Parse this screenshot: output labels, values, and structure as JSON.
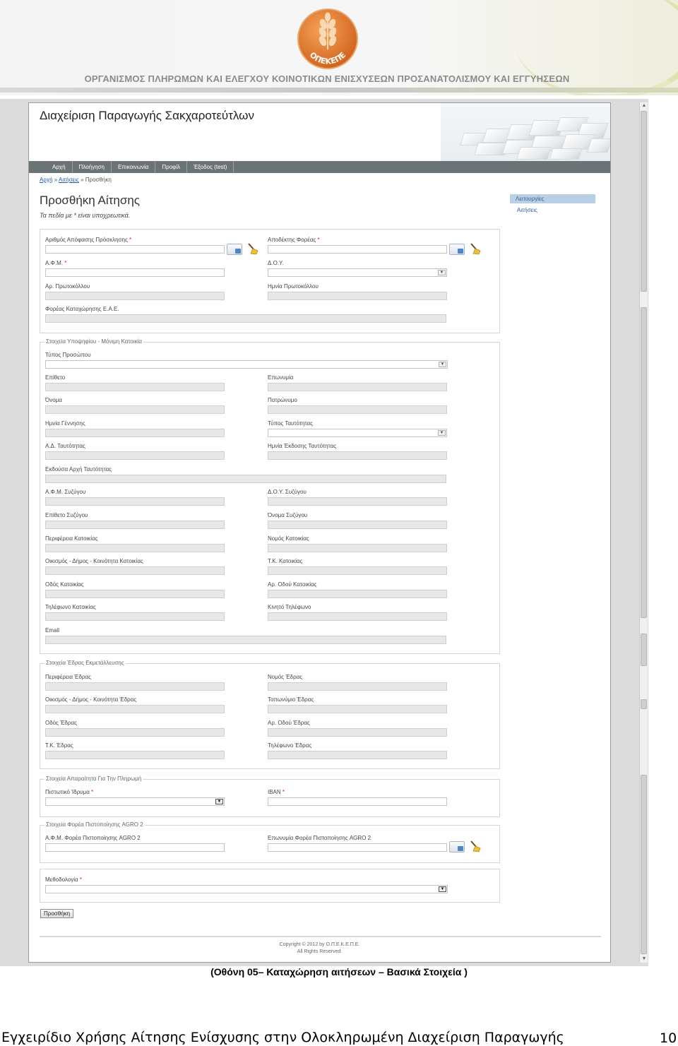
{
  "banner": {
    "title": "ΟΡΓΑΝΙΣΜΟΣ ΠΛΗΡΩΜΩΝ ΚΑΙ ΕΛΕΓΧΟΥ ΚΟΙΝΟΤΙΚΩΝ ΕΝΙΣΧΥΣΕΩΝ ΠΡΟΣΑΝΑΤΟΛΙΣΜΟΥ ΚΑΙ ΕΓΓΥΗΣΕΩΝ",
    "logo_text": "ΟΠΕΚΕΠΕ"
  },
  "app": {
    "title": "Διαχείριση Παραγωγής Σακχαροτεύτλων"
  },
  "nav": {
    "items": [
      "Αρχή",
      "Πλοήγηση",
      "Επικοινωνία",
      "Προφίλ",
      "Έξοδος (test)"
    ]
  },
  "breadcrumb": {
    "home": "Αρχή",
    "sep": " » ",
    "applications": "Αιτήσεις",
    "current": "Προσθήκη"
  },
  "page": {
    "heading": "Προσθήκη Αίτησης",
    "required_note": "Τα πεδία με * είναι υποχρεωτικά."
  },
  "side_menu": {
    "active": "Λειτουργίες",
    "link": "Αιτήσεις"
  },
  "sections": {
    "main": {
      "decision_number": "Αριθμός Απόφασης Πρόσκλησης",
      "recipient": "Αποδέκτης Φορέας",
      "afm": "Α.Φ.Μ.",
      "doy": "Δ.Ο.Υ.",
      "protocol_number": "Αρ. Πρωτοκόλλου",
      "protocol_date": "Ημνία Πρωτοκόλλου",
      "eae_entity": "Φορέας Καταχώρησης Ε.Α.Ε."
    },
    "applicant": {
      "legend": "Στοιχεία Υποψηφίου - Μόνιμη Κατοικία",
      "person_type": "Τύπος Προσώπου",
      "surname": "Επίθετο",
      "company_name": "Επωνυμία",
      "first_name": "Όνομα",
      "father_name": "Πατρώνυμο",
      "birth_date": "Ημνία Γέννησης",
      "id_type": "Τύπος Ταυτότητας",
      "id_number": "Α.Δ. Ταυτότητας",
      "id_issue_date": "Ημνία Έκδοσης Ταυτότητας",
      "id_authority": "Εκδούσα Αρχή Ταυτότητας",
      "spouse_afm": "Α.Φ.Μ. Συζύγου",
      "spouse_doy": "Δ.Ο.Υ. Συζύγου",
      "spouse_surname": "Επίθετο Συζύγου",
      "spouse_name": "Όνομα Συζύγου",
      "region": "Περιφέρεια Κατοικίας",
      "prefecture": "Νομός Κατοικίας",
      "settlement": "Οικισμός - Δήμος - Κοινότητα Κατοικίας",
      "postal_code": "Τ.Κ. Κατοικίας",
      "street": "Οδός Κατοικίας",
      "street_number": "Αρ. Οδού Κατοικίας",
      "phone": "Τηλέφωνο Κατοικίας",
      "mobile": "Κινητό Τηλέφωνο",
      "email": "Email"
    },
    "seat": {
      "legend": "Στοιχεία Έδρας Εκμετάλλευσης",
      "region": "Περιφέρεια Έδρας",
      "prefecture": "Νομός Έδρας",
      "settlement": "Οικισμός - Δήμος - Κοινότητα Έδρας",
      "locality": "Τοπωνύμιο Έδρας",
      "street": "Οδός Έδρας",
      "street_number": "Αρ. Οδού Έδρας",
      "postal_code": "Τ.Κ. Έδρας",
      "phone": "Τηλέφωνο Έδρας"
    },
    "payment": {
      "legend": "Στοιχεία Απαραίτητα Για Την Πληρωμή",
      "bank": "Πιστωτικό Ίδρυμα",
      "iban": "IBAN"
    },
    "agro": {
      "legend": "Στοιχεία Φορέα Πιστοποίησης AGRO 2",
      "afm": "Α.Φ.Μ. Φορέα Πιστοποίησης AGRO 2",
      "name": "Επωνυμία Φορέα Πιστοποίησης AGRO 2"
    },
    "method": {
      "methodology": "Μεθοδολογία"
    }
  },
  "required_mark": " *",
  "submit_label": "Προσθήκη",
  "footer": {
    "line1": "Copyright © 2012 by Ο.Π.Ε.Κ.Ε.Π.Ε.",
    "line2": "All Rights Reserved."
  },
  "caption": "(Οθόνη 05– Καταχώρηση αιτήσεων – Βασικά Στοιχεία )",
  "doc_footer": {
    "text": "Εγχειρίδιο Χρήσης Αίτησης Ενίσχυσης στην Ολοκληρωμένη Διαχείριση Παραγωγής Σακχαρότευτλων",
    "page": "10"
  },
  "colors": {
    "nav_bg": "#6b7377",
    "side_active": "#b8cfe4",
    "logo_orange": "#e07a2e",
    "required": "#d02020"
  }
}
